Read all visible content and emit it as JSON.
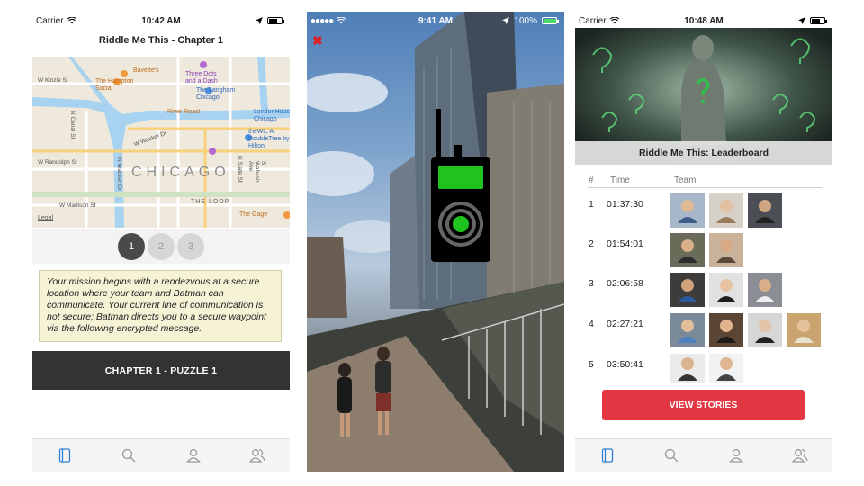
{
  "screens": {
    "chapter": {
      "status": {
        "carrier": "Carrier",
        "time": "10:42 AM"
      },
      "title": "Riddle Me This - Chapter 1",
      "map": {
        "city_label": "CHICAGO",
        "labels": [
          "Bavette's",
          "The Hampton Social",
          "Three Dots and a Dash",
          "The Langham Chicago",
          "River Roast",
          "LondonHouse Chicago",
          "theWit, A DoubleTree by Hilton",
          "The Loop",
          "The Gage",
          "W Kinzie St",
          "N Canal St",
          "W Wacker Dr",
          "W Randolph St",
          "N Wacker Dr",
          "W Madison St",
          "N State St",
          "S Wabash Ave",
          "Legal"
        ]
      },
      "pager": [
        "1",
        "2",
        "3"
      ],
      "pager_active_index": 0,
      "mission_text": "Your mission begins with a rendezvous at a secure location where your team and Batman can communicate. Your current line of communication is not secure; Batman directs you to a secure waypoint via the following encrypted message.",
      "puzzle_button": "CHAPTER 1 - PUZZLE 1",
      "tabs": [
        "book-icon",
        "search-icon",
        "person-icon",
        "people-icon"
      ],
      "active_tab": 0
    },
    "camera": {
      "status": {
        "carrier": "●●●●● ",
        "time": "9:41 AM",
        "battery": "100%"
      },
      "close_glyph": "✖",
      "overlay_icon": "walkie-talkie-icon"
    },
    "leaderboard": {
      "status": {
        "carrier": "Carrier",
        "time": "10:48 AM"
      },
      "banner_title": "Riddle Me This: Leaderboard",
      "columns": {
        "rank": "#",
        "time": "Time",
        "team": "Team"
      },
      "rows": [
        {
          "rank": "1",
          "time": "01:37:30",
          "members": 3
        },
        {
          "rank": "2",
          "time": "01:54:01",
          "members": 2
        },
        {
          "rank": "3",
          "time": "02:06:58",
          "members": 3
        },
        {
          "rank": "4",
          "time": "02:27:21",
          "members": 4
        },
        {
          "rank": "5",
          "time": "03:50:41",
          "members": 2
        }
      ],
      "view_button": "VIEW STORIES",
      "tabs": [
        "book-icon",
        "search-icon",
        "person-icon",
        "people-icon"
      ],
      "active_tab": 0
    }
  },
  "colors": {
    "accent_blue": "#2f7fd8",
    "button_dark": "#333333",
    "button_red": "#e23743",
    "mission_bg": "#f5f2d6",
    "radio_green": "#1fc21f"
  }
}
